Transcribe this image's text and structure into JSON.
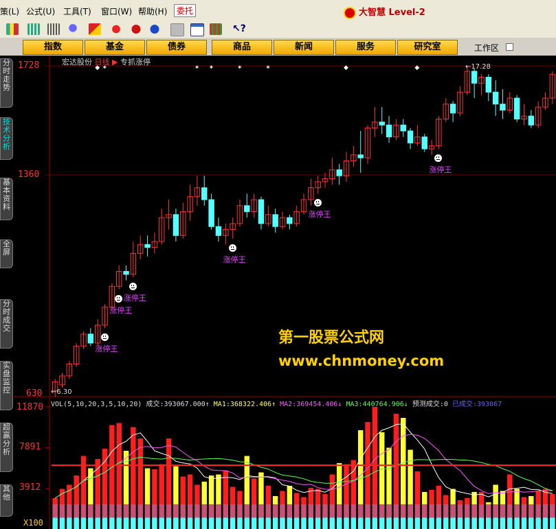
{
  "menu": {
    "items": [
      "策(L)",
      "公式(U)",
      "工具(T)",
      "窗口(W)",
      "帮助(H)"
    ],
    "entrust": "委托",
    "brand": "大智慧 Level-2"
  },
  "nav": {
    "buttons": [
      "指数",
      "基金",
      "债券",
      "商品",
      "新闻",
      "服务",
      "研究室"
    ],
    "workspace": "工作区"
  },
  "sidebar": {
    "tabs": [
      "分时走势",
      "技术分析",
      "基本资料",
      "全屏",
      "分时成交",
      "实盘监控",
      "超赢分析",
      "其他"
    ],
    "active": "技术分析"
  },
  "chart_header": {
    "stock_name": "宏达股份",
    "period": "日线",
    "indicator": "专抓涨停"
  },
  "price_axis": {
    "labels": [
      "1728",
      "1360",
      "630"
    ],
    "top_marker": "17.28",
    "bottom_marker": "6.30"
  },
  "volume_axis": {
    "labels": [
      "11870",
      "7891",
      "3912",
      "X100"
    ]
  },
  "signal_label": "涨停王",
  "watermark": {
    "line1": "第一股票公式网",
    "line2": "www.chnmoney.com"
  },
  "volume_info": {
    "params": "VOL(5,10,20,3,5,10,20)",
    "chengjiao_label": "成交:",
    "chengjiao": "393067.000↑",
    "ma1_label": "MA1:",
    "ma1": "368322.406↑",
    "ma2_label": "MA2:",
    "ma2": "369454.406↓",
    "ma3_label": "MA3:",
    "ma3": "440764.906↓",
    "forecast_label": "预测成交:",
    "forecast": "0",
    "done_label": "已成交:",
    "done": "393067"
  },
  "colors": {
    "up": "#ff3333",
    "down": "#55ffff",
    "zt_label": "#e040ff",
    "vol_red": "#ff1e1e",
    "vol_yellow": "#ffff33",
    "vol_cyan": "#55ffff",
    "vol_pink": "#c8507a",
    "axis": "#ff3030"
  },
  "chart_data": [
    {
      "type": "candlestick",
      "title": "宏达股份 日线",
      "ylim": [
        6.3,
        17.28
      ],
      "markers_top": "◆ ✶",
      "candles": [
        [
          6.4,
          6.7,
          6.2,
          6.8
        ],
        [
          6.6,
          6.9,
          6.5,
          7.0
        ],
        [
          6.9,
          7.3,
          6.8,
          7.4
        ],
        [
          7.3,
          7.9,
          7.2,
          8.0
        ],
        [
          7.9,
          8.3,
          7.8,
          8.4
        ],
        [
          8.3,
          8.0,
          7.9,
          8.5
        ],
        [
          8.0,
          8.6,
          7.9,
          8.8
        ],
        [
          8.6,
          9.2,
          8.5,
          9.3
        ],
        [
          9.2,
          9.9,
          9.1,
          10.0
        ],
        [
          9.9,
          10.4,
          9.8,
          10.6
        ],
        [
          10.4,
          10.3,
          10.1,
          10.6
        ],
        [
          10.3,
          11.0,
          10.2,
          11.4
        ],
        [
          11.0,
          11.3,
          10.8,
          11.6
        ],
        [
          11.3,
          11.2,
          10.9,
          11.6
        ],
        [
          11.2,
          11.4,
          11.0,
          11.7
        ],
        [
          11.4,
          12.2,
          11.3,
          12.5
        ],
        [
          12.2,
          12.3,
          11.8,
          12.8
        ],
        [
          12.3,
          11.6,
          11.4,
          12.5
        ],
        [
          11.6,
          12.4,
          11.5,
          12.7
        ],
        [
          12.4,
          12.9,
          12.1,
          13.3
        ],
        [
          12.9,
          13.2,
          12.6,
          13.6
        ],
        [
          13.2,
          12.8,
          12.6,
          13.6
        ],
        [
          12.8,
          11.9,
          11.8,
          13.0
        ],
        [
          11.9,
          11.6,
          11.4,
          12.2
        ],
        [
          11.6,
          11.8,
          11.3,
          12.0
        ],
        [
          11.8,
          12.0,
          11.5,
          12.2
        ],
        [
          12.0,
          12.6,
          11.9,
          12.8
        ],
        [
          12.6,
          12.4,
          12.2,
          13.0
        ],
        [
          12.4,
          12.8,
          12.2,
          13.0
        ],
        [
          12.8,
          12.0,
          11.8,
          12.9
        ],
        [
          12.0,
          12.3,
          11.9,
          12.6
        ],
        [
          12.3,
          11.9,
          11.7,
          12.5
        ],
        [
          11.9,
          12.2,
          11.8,
          12.4
        ],
        [
          12.2,
          12.0,
          11.8,
          12.3
        ],
        [
          12.0,
          12.4,
          11.9,
          12.6
        ],
        [
          12.4,
          12.8,
          12.3,
          13.0
        ],
        [
          12.8,
          13.2,
          12.6,
          13.5
        ],
        [
          13.2,
          13.4,
          13.0,
          13.6
        ],
        [
          13.4,
          13.5,
          13.2,
          13.7
        ],
        [
          13.5,
          13.8,
          13.3,
          14.2
        ],
        [
          13.8,
          13.6,
          13.3,
          14.0
        ],
        [
          13.6,
          14.1,
          13.4,
          14.4
        ],
        [
          14.1,
          14.3,
          13.9,
          14.6
        ],
        [
          14.3,
          14.2,
          13.7,
          15.1
        ],
        [
          14.2,
          15.2,
          14.0,
          15.3
        ],
        [
          15.2,
          15.4,
          14.9,
          15.9
        ],
        [
          15.4,
          15.3,
          15.0,
          15.9
        ],
        [
          15.3,
          14.9,
          14.7,
          15.6
        ],
        [
          14.9,
          15.3,
          14.8,
          15.5
        ],
        [
          15.3,
          15.1,
          14.9,
          15.5
        ],
        [
          15.1,
          14.7,
          14.5,
          15.2
        ],
        [
          14.7,
          14.9,
          14.6,
          15.3
        ],
        [
          14.9,
          14.5,
          14.4,
          15.0
        ],
        [
          14.5,
          14.6,
          14.3,
          14.8
        ],
        [
          14.6,
          15.5,
          14.5,
          15.6
        ],
        [
          15.5,
          16.0,
          15.4,
          16.2
        ],
        [
          16.0,
          15.7,
          15.4,
          16.1
        ],
        [
          15.7,
          16.4,
          15.6,
          16.6
        ],
        [
          16.4,
          17.1,
          16.3,
          17.28
        ],
        [
          17.1,
          16.7,
          16.2,
          17.2
        ],
        [
          16.7,
          16.9,
          16.3,
          17.0
        ],
        [
          16.9,
          16.4,
          16.1,
          17.0
        ],
        [
          16.4,
          16.0,
          15.6,
          16.8
        ],
        [
          16.0,
          15.8,
          15.5,
          16.5
        ],
        [
          15.8,
          16.2,
          15.7,
          16.4
        ],
        [
          16.2,
          15.5,
          15.4,
          16.3
        ],
        [
          15.5,
          15.6,
          15.3,
          16.0
        ],
        [
          15.6,
          15.3,
          15.2,
          15.8
        ],
        [
          15.3,
          15.9,
          15.2,
          16.1
        ],
        [
          15.9,
          16.2,
          15.8,
          16.4
        ],
        [
          16.2,
          17.0,
          16.0,
          17.1
        ]
      ],
      "signals": [
        7,
        9,
        11,
        25,
        37,
        54
      ],
      "signal_label": "涨停王"
    },
    {
      "type": "bar",
      "title": "VOL(5,10,20,3,5,10,20)",
      "ylim": [
        0,
        11870
      ],
      "volumes": [
        3000,
        3900,
        4300,
        5200,
        7100,
        5900,
        6800,
        7800,
        10100,
        10300,
        7600,
        9900,
        8800,
        5900,
        5800,
        6300,
        8800,
        6100,
        5100,
        5300,
        4300,
        4600,
        5200,
        5300,
        5700,
        4100,
        3700,
        7100,
        4900,
        5500,
        4200,
        3200,
        3700,
        4200,
        3500,
        3100,
        4000,
        3900,
        3400,
        5300,
        6400,
        6300,
        6700,
        9600,
        10400,
        11870,
        9400,
        7900,
        11200,
        10800,
        7700,
        5600,
        3600,
        3800,
        4200,
        3300,
        3900,
        2800,
        3000,
        3600,
        3600,
        2600,
        4300,
        3700,
        5300,
        3900,
        3100,
        3200,
        3700,
        3900,
        3400
      ]
    }
  ]
}
